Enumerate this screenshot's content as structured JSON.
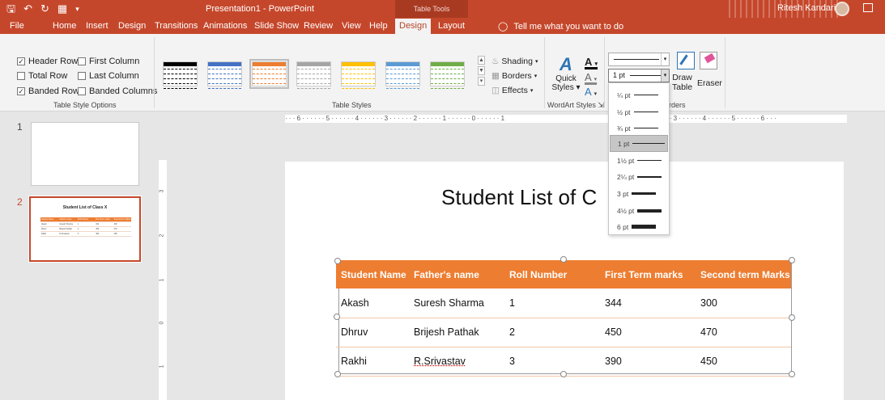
{
  "titlebar": {
    "document_title": "Presentation1  -  PowerPoint",
    "contextual_group": "Table Tools",
    "user_name": "Ritesh Kandari",
    "qat": [
      "save-icon",
      "undo-icon",
      "redo-icon",
      "present-icon",
      "customize-icon"
    ]
  },
  "tabs": [
    "File",
    "Home",
    "Insert",
    "Design",
    "Transitions",
    "Animations",
    "Slide Show",
    "Review",
    "View",
    "Help",
    "Design",
    "Layout"
  ],
  "active_tab": "Design",
  "tell_me": "Tell me what you want to do",
  "ribbon": {
    "table_style_options": {
      "label": "Table Style Options",
      "options": [
        {
          "label": "Header Row",
          "checked": true
        },
        {
          "label": "First Column",
          "checked": false
        },
        {
          "label": "Total Row",
          "checked": false
        },
        {
          "label": "Last Column",
          "checked": false
        },
        {
          "label": "Banded Rows",
          "checked": true
        },
        {
          "label": "Banded Columns",
          "checked": false
        }
      ]
    },
    "table_styles": {
      "label": "Table Styles",
      "thumb_colors": [
        "#000000",
        "#4472c4",
        "#ed7d31",
        "#a5a5a5",
        "#ffc000",
        "#5b9bd5",
        "#70ad47"
      ],
      "selected_index": 2
    },
    "shading_label": "Shading",
    "borders_label": "Borders",
    "effects_label": "Effects",
    "quick_styles_line1": "Quick",
    "quick_styles_line2": "Styles",
    "wordart_label": "WordArt Styles",
    "draw_borders": {
      "pen_weight": "1 pt",
      "draw_table_line1": "Draw",
      "draw_table_line2": "Table",
      "eraser_label": "Eraser",
      "group_label_visible": "rders"
    }
  },
  "pen_weight_options": [
    {
      "label": "¼ pt",
      "weight": 0.25,
      "selected": false
    },
    {
      "label": "½ pt",
      "weight": 0.5,
      "selected": false
    },
    {
      "label": "¾ pt",
      "weight": 0.75,
      "selected": false
    },
    {
      "label": "1 pt",
      "weight": 1,
      "selected": true
    },
    {
      "label": "1½ pt",
      "weight": 1.5,
      "selected": false
    },
    {
      "label": "2¼ pt",
      "weight": 2.25,
      "selected": false
    },
    {
      "label": "3 pt",
      "weight": 3,
      "selected": false
    },
    {
      "label": "4½ pt",
      "weight": 4.5,
      "selected": false
    },
    {
      "label": "6 pt",
      "weight": 6,
      "selected": false
    }
  ],
  "slides": [
    {
      "number": "1",
      "title": ""
    },
    {
      "number": "2",
      "title": "Student List of Class X"
    }
  ],
  "ruler_h": "· · · 6 · · · · · · 5 · · · · · · 4 · · · · · · 3 · · · · · · 2 · · · · · · 1 · · · · · · 0 · · · · · · 1",
  "ruler_h_right": "· · · 3 · · · · · · 4 · · · · · · 5 · · · · · · 6 · · ·",
  "ruler_v": [
    "3",
    "2",
    "1",
    "0",
    "1"
  ],
  "slide": {
    "title": "Student List of C",
    "table": {
      "headers": [
        "Student Name",
        "Father's name",
        "Roll Number",
        "First Term marks",
        "Second term Marks"
      ],
      "rows": [
        [
          "Akash",
          "Suresh Sharma",
          "1",
          "344",
          "300"
        ],
        [
          "Dhruv",
          "Brijesh Pathak",
          "2",
          "450",
          "470"
        ],
        [
          "Rakhi",
          "R.Srivastav",
          "3",
          "390",
          "450"
        ]
      ]
    }
  },
  "colors": {
    "brand": "#c5472b",
    "table_header": "#ed7d31",
    "ribbon_bg": "#f3f3f3"
  }
}
